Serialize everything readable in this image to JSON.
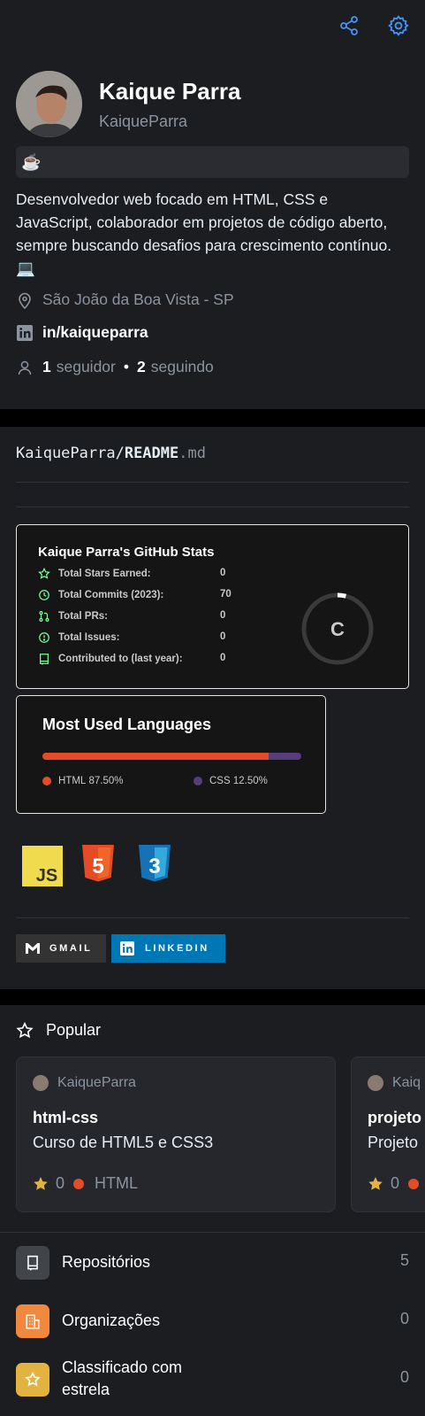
{
  "header": {
    "share_icon": "share-icon",
    "settings_icon": "gear-icon",
    "accent_color": "#4493f8"
  },
  "profile": {
    "name": "Kaique Parra",
    "username": "KaiqueParra",
    "status_emoji": "☕",
    "bio": "Desenvolvedor web focado em HTML, CSS e JavaScript, colaborador em projetos de código aberto, sempre buscando desafios para crescimento contínuo. 💻",
    "location": "São João da Boa Vista - SP",
    "linkedin": "in/kaiqueparra",
    "followers_count": "1",
    "followers_label": "seguidor",
    "following_count": "2",
    "following_label": "seguindo"
  },
  "readme": {
    "owner": "KaiqueParra/",
    "file_name": "README",
    "file_ext": ".md",
    "stats_card": {
      "title": "Kaique Parra's GitHub Stats",
      "rows": [
        {
          "label": "Total Stars Earned:",
          "value": "0",
          "icon": "star-icon"
        },
        {
          "label": "Total Commits (2023):",
          "value": "70",
          "icon": "history-icon"
        },
        {
          "label": "Total PRs:",
          "value": "0",
          "icon": "pull-request-icon"
        },
        {
          "label": "Total Issues:",
          "value": "0",
          "icon": "issue-icon"
        },
        {
          "label": "Contributed to (last year):",
          "value": "0",
          "icon": "repo-icon"
        }
      ],
      "rank": "C",
      "rank_progress_percent": 4,
      "icon_color": "#79ff97"
    },
    "languages_card": {
      "title": "Most Used Languages",
      "languages": [
        {
          "name": "HTML",
          "percent_label": "87.50%",
          "percent": 87.5,
          "color": "#e34c26"
        },
        {
          "name": "CSS",
          "percent_label": "12.50%",
          "percent": 12.5,
          "color": "#563d7c"
        }
      ]
    },
    "tech_badges": [
      "JS",
      "5",
      "3"
    ],
    "contact_badges": [
      {
        "label": "GMAIL",
        "color": "#333333"
      },
      {
        "label": "LINKEDIN",
        "color": "#0077b5"
      }
    ]
  },
  "popular": {
    "title": "Popular",
    "repos": [
      {
        "owner": "KaiqueParra",
        "name": "html-css",
        "description": "Curso de HTML5 e CSS3",
        "stars": "0",
        "language": "HTML"
      },
      {
        "owner": "Kaiq",
        "name": "projeto",
        "description": "Projeto",
        "stars": "0",
        "language": ""
      }
    ]
  },
  "menu": [
    {
      "label": "Repositórios",
      "count": "5",
      "icon": "repo-icon",
      "color": "#414449"
    },
    {
      "label": "Organizações",
      "count": "0",
      "icon": "organization-icon",
      "color": "#f0883e"
    },
    {
      "label": "Classificado com estrela",
      "count": "0",
      "icon": "star-icon",
      "color": "#e3b341"
    }
  ]
}
